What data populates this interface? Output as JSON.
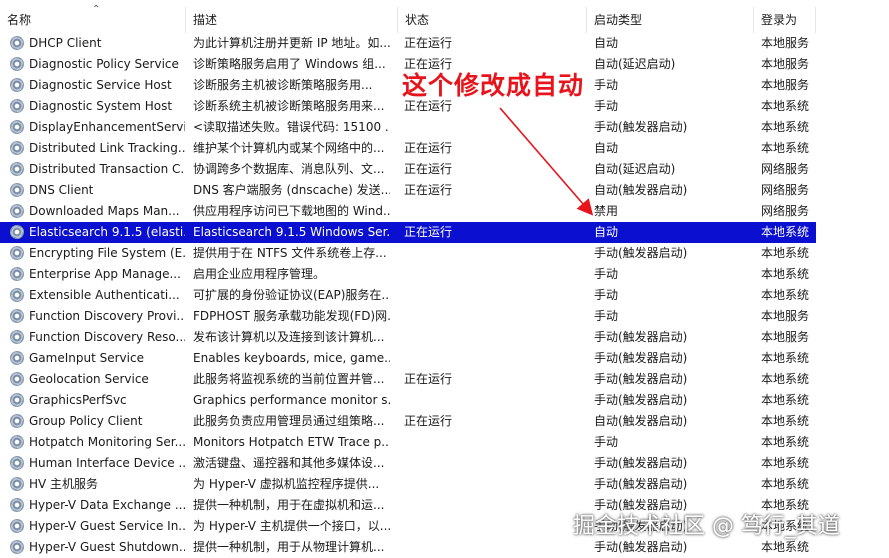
{
  "columns": {
    "name": "名称",
    "description": "描述",
    "status": "状态",
    "startup_type": "启动类型",
    "logon_as": "登录为"
  },
  "services": [
    {
      "name": "DHCP Client",
      "description": "为此计算机注册并更新 IP 地址。如...",
      "status": "正在运行",
      "startup": "自动",
      "logon": "本地服务"
    },
    {
      "name": "Diagnostic Policy Service",
      "description": "诊断策略服务启用了 Windows 组...",
      "status": "正在运行",
      "startup": "自动(延迟启动)",
      "logon": "本地服务"
    },
    {
      "name": "Diagnostic Service Host",
      "description": "诊断服务主机被诊断策略服务用...",
      "status": "",
      "startup": "手动",
      "logon": "本地服务"
    },
    {
      "name": "Diagnostic System Host",
      "description": "诊断系统主机被诊断策略服务用来...",
      "status": "正在运行",
      "startup": "手动",
      "logon": "本地系统"
    },
    {
      "name": "DisplayEnhancementServi...",
      "description": "<读取描述失败。错误代码: 15100 ...",
      "status": "",
      "startup": "手动(触发器启动)",
      "logon": "本地系统"
    },
    {
      "name": "Distributed Link Tracking...",
      "description": "维护某个计算机内或某个网络中的...",
      "status": "正在运行",
      "startup": "自动",
      "logon": "本地系统"
    },
    {
      "name": "Distributed Transaction C...",
      "description": "协调跨多个数据库、消息队列、文...",
      "status": "正在运行",
      "startup": "自动(延迟启动)",
      "logon": "网络服务"
    },
    {
      "name": "DNS Client",
      "description": "DNS 客户端服务 (dnscache) 发送...",
      "status": "正在运行",
      "startup": "自动(触发器启动)",
      "logon": "网络服务"
    },
    {
      "name": "Downloaded Maps Man...",
      "description": "供应用程序访问已下载地图的 Wind...",
      "status": "",
      "startup": "禁用",
      "logon": "网络服务"
    },
    {
      "name": "Elasticsearch 9.1.5 (elasti...",
      "description": "Elasticsearch 9.1.5 Windows Ser...",
      "status": "正在运行",
      "startup": "自动",
      "logon": "本地系统",
      "selected": true
    },
    {
      "name": "Encrypting File System (E...",
      "description": "提供用于在 NTFS 文件系统卷上存...",
      "status": "",
      "startup": "手动(触发器启动)",
      "logon": "本地系统"
    },
    {
      "name": "Enterprise App Manage...",
      "description": "启用企业应用程序管理。",
      "status": "",
      "startup": "手动",
      "logon": "本地系统"
    },
    {
      "name": "Extensible Authenticati...",
      "description": "可扩展的身份验证协议(EAP)服务在...",
      "status": "",
      "startup": "手动",
      "logon": "本地系统"
    },
    {
      "name": "Function Discovery Provi...",
      "description": "FDPHOST 服务承载功能发现(FD)网...",
      "status": "",
      "startup": "手动",
      "logon": "本地服务"
    },
    {
      "name": "Function Discovery Reso...",
      "description": "发布该计算机以及连接到该计算机...",
      "status": "",
      "startup": "手动(触发器启动)",
      "logon": "本地服务"
    },
    {
      "name": "GameInput Service",
      "description": "Enables keyboards, mice, game...",
      "status": "",
      "startup": "手动(触发器启动)",
      "logon": "本地系统"
    },
    {
      "name": "Geolocation Service",
      "description": "此服务将监视系统的当前位置并管...",
      "status": "正在运行",
      "startup": "手动(触发器启动)",
      "logon": "本地系统"
    },
    {
      "name": "GraphicsPerfSvc",
      "description": "Graphics performance monitor s...",
      "status": "",
      "startup": "手动(触发器启动)",
      "logon": "本地系统"
    },
    {
      "name": "Group Policy Client",
      "description": "此服务负责应用管理员通过组策略...",
      "status": "正在运行",
      "startup": "自动(触发器启动)",
      "logon": "本地系统"
    },
    {
      "name": "Hotpatch Monitoring Ser...",
      "description": "Monitors Hotpatch ETW Trace p...",
      "status": "",
      "startup": "手动",
      "logon": "本地系统"
    },
    {
      "name": "Human Interface Device ...",
      "description": "激活键盘、遥控器和其他多媒体设...",
      "status": "",
      "startup": "手动(触发器启动)",
      "logon": "本地系统"
    },
    {
      "name": "HV 主机服务",
      "description": "为 Hyper-V 虚拟机监控程序提供...",
      "status": "",
      "startup": "手动(触发器启动)",
      "logon": "本地系统"
    },
    {
      "name": "Hyper-V Data Exchange ...",
      "description": "提供一种机制，用于在虚拟机和运...",
      "status": "",
      "startup": "手动(触发器启动)",
      "logon": "本地系统"
    },
    {
      "name": "Hyper-V Guest Service In...",
      "description": "为 Hyper-V 主机提供一个接口，以...",
      "status": "",
      "startup": "手动(触发器启动)",
      "logon": "本地系统"
    },
    {
      "name": "Hyper-V Guest Shutdown...",
      "description": "提供一种机制，用于从物理计算机...",
      "status": "",
      "startup": "手动(触发器启动)",
      "logon": "本地系统"
    }
  ],
  "annotation": {
    "text": "这个修改成自动",
    "color": "#e8141c"
  },
  "watermark": "掘金技术社区 @ 笃行_其道",
  "icons": {
    "service": "gear-icon",
    "sort": "sort-ascending-icon"
  },
  "colors": {
    "selection": "#0a0fd0",
    "annotation": "#e8141c"
  }
}
